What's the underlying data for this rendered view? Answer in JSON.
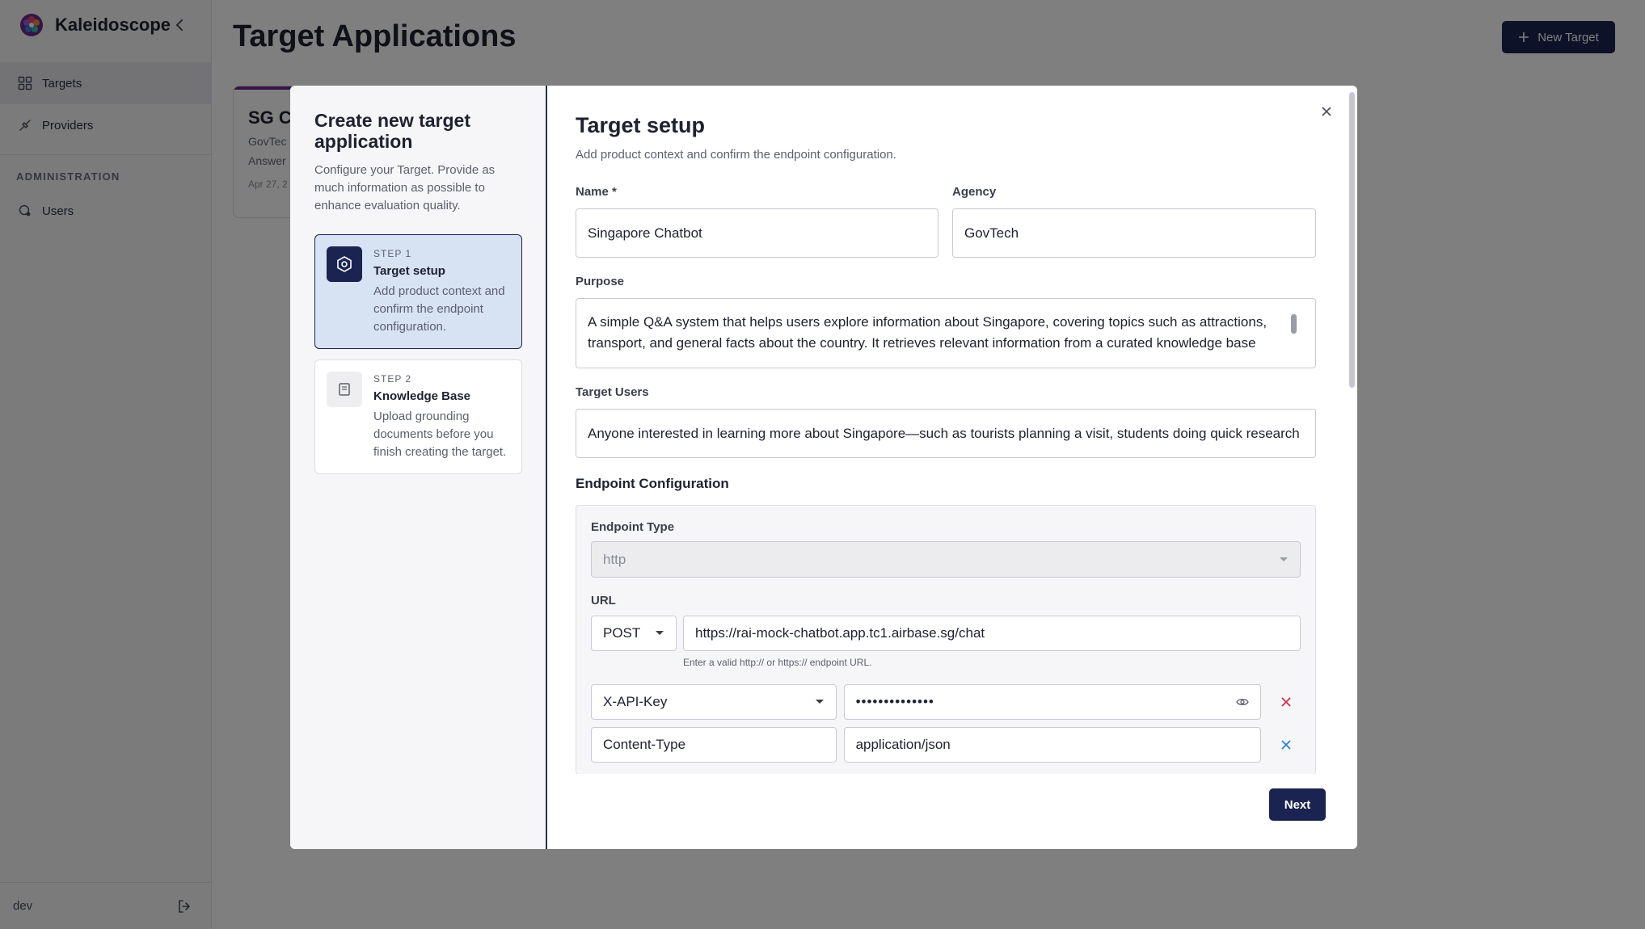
{
  "app": {
    "name": "Kaleidoscope"
  },
  "sidebar": {
    "items": [
      {
        "label": "Targets",
        "icon": "grid-icon"
      },
      {
        "label": "Providers",
        "icon": "plug-icon"
      }
    ],
    "section_label": "ADMINISTRATION",
    "admin_items": [
      {
        "label": "Users",
        "icon": "users-icon"
      }
    ],
    "footer": {
      "user": "dev",
      "logout_icon": "logout-icon"
    }
  },
  "page": {
    "title": "Target Applications",
    "new_target_label": "New Target"
  },
  "background_card": {
    "title": "SG Cl",
    "agency": "GovTec",
    "desc": "Answer",
    "date": "Apr 27, 2"
  },
  "modal": {
    "title": "Create new target application",
    "description": "Configure your Target. Provide as much information as possible to enhance evaluation quality.",
    "steps": [
      {
        "number": "STEP 1",
        "name": "Target setup",
        "description": "Add product context and confirm the endpoint configuration.",
        "icon": "settings-hexagon-icon"
      },
      {
        "number": "STEP 2",
        "name": "Knowledge Base",
        "description": "Upload grounding documents before you finish creating the target.",
        "icon": "book-icon"
      }
    ],
    "form": {
      "title": "Target setup",
      "subtitle": "Add product context and confirm the endpoint configuration.",
      "name_label": "Name *",
      "name_value": "Singapore Chatbot",
      "agency_label": "Agency",
      "agency_value": "GovTech",
      "purpose_label": "Purpose",
      "purpose_value": "A simple Q&A system that helps users explore information about Singapore, covering topics such as attractions, transport, and general facts about the country. It retrieves relevant information from a curated knowledge base",
      "target_users_label": "Target Users",
      "target_users_value": "Anyone interested in learning more about Singapore—such as tourists planning a visit, students doing quick research",
      "endpoint": {
        "section_title": "Endpoint Configuration",
        "type_label": "Endpoint Type",
        "type_value": "http",
        "url_label": "URL",
        "method": "POST",
        "url": "https://rai-mock-chatbot.app.tc1.airbase.sg/chat",
        "url_hint": "Enter a valid http:// or https:// endpoint URL.",
        "headers": [
          {
            "key": "X-API-Key",
            "value": "••••••••••••••"
          },
          {
            "key": "Content-Type",
            "value": "application/json"
          }
        ]
      }
    },
    "next_label": "Next"
  },
  "colors": {
    "primary": "#1b2450",
    "active_step_bg": "#d7e2f2",
    "delete_red": "#d0314b",
    "delete_blue": "#2f7fd1"
  }
}
